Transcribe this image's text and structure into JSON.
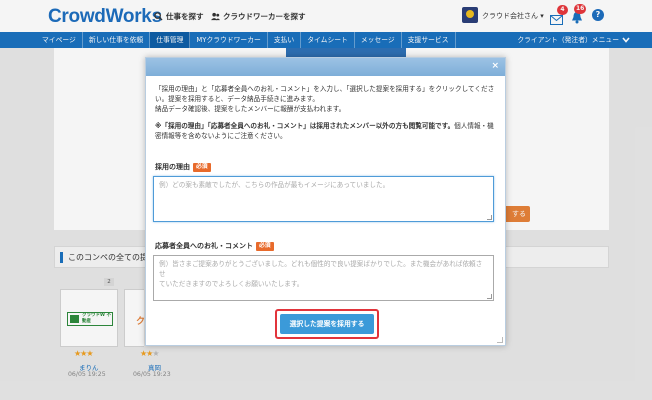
{
  "header": {
    "logo": "CrowdWorks",
    "find_work": "仕事を探す",
    "find_workers": "クラウドワーカーを探す",
    "company": "クラウド会社さん",
    "message_badge": "4",
    "notification_badge": "16",
    "help": "?"
  },
  "nav": {
    "items": [
      "マイページ",
      "新しい仕事を依頼",
      "仕事管理",
      "MYクラウドワーカー",
      "支払い",
      "タイムシート",
      "メッセージ",
      "支援サービス"
    ],
    "right_menu": "クライアント（発注者）メニュー"
  },
  "background": {
    "orange_button": "する",
    "section_title": "このコンペの全ての提",
    "entry_count": "2",
    "cards": [
      {
        "logo_text": "クラウドW 不動産",
        "stars": 3,
        "name": "まりん",
        "date": "06/05 19:25"
      },
      {
        "logo_text": "ク",
        "stars": 2,
        "name": "真岡",
        "date": "06/05 19:23"
      }
    ]
  },
  "modal": {
    "close": "×",
    "intro_line1": "「採用の理由」と「応募者全員へのお礼・コメント」を入力し、「選択した提案を採用する」をクリックしてくださ",
    "intro_line2": "い。提案を採用すると、データ納品手続きに進みます。",
    "intro_line3": "納品データ確認後、提案をしたメンバーに報酬が支払われます。",
    "note_bold": "※「採用の理由」「応募者全員へのお礼・コメント」は採用されたメンバー以外の方も閲覧可能です。",
    "note_rest": "個人情報・機",
    "note_line2": "密情報等を含めないようにご注意ください。",
    "reason_label": "採用の理由",
    "required": "必須",
    "reason_placeholder": "例）どの案も素敵でしたが、こちらの作品が最もイメージにあっていました。",
    "thanks_label": "応募者全員へのお礼・コメント",
    "thanks_placeholder_1": "例）皆さまご提案ありがとうございました。どれも個性的で良い提案ばかりでした。また機会があれば依頼させ",
    "thanks_placeholder_2": "ていただきますのでよろしくお願いいたします。",
    "adopt_button": "選択した提案を採用する"
  },
  "colors": {
    "brand_blue": "#1b72c0",
    "required_orange": "#e86a2b",
    "primary_button": "#3b9ad9",
    "highlight_red": "#e2343b"
  }
}
